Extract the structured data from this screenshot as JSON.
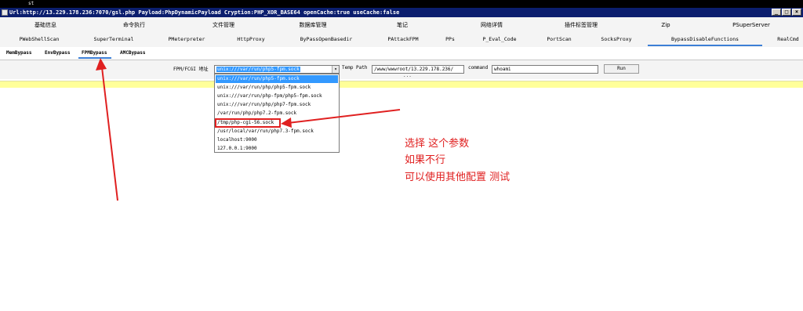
{
  "top_strip_text": "st",
  "window": {
    "title": "Url:http://13.229.178.236:7070/gsl.php Payload:PhpDynamicPayload Cryption:PHP_XOR_BASE64 openCache:true useCache:false",
    "buttons": {
      "minimize": "_",
      "maximize": "□",
      "close": "×"
    }
  },
  "main_menu": [
    "基础信息",
    "命令执行",
    "文件管理",
    "数据库管理",
    "笔记",
    "网络详情",
    "插件标签管理",
    "Zip",
    "PSuperServer"
  ],
  "plugin_menu": [
    "PWebShellScan",
    "SuperTerminal",
    "PMeterpreter",
    "HttpProxy",
    "ByPassOpenBasedir",
    "PAttackFPM",
    "PPs",
    "P_Eval_Code",
    "PortScan",
    "SocksProxy",
    "BypassDisableFunctions",
    "RealCmd"
  ],
  "plugin_menu_active": "BypassDisableFunctions",
  "sub_tabs": [
    "MemBypass",
    "EnvBypass",
    "FPMBypass",
    "AMCBypass"
  ],
  "sub_tabs_active": "FPMBypass",
  "form": {
    "fpm_label": "FPM/FCGI 地址",
    "fpm_value": "unix:///var/run/php5-fpm.sock",
    "dropdown_arrow": "▾",
    "temp_path_label": "Temp Path",
    "temp_path_value": "/www/wwwroot/13.229.178.236/",
    "command_label": "command",
    "command_value": "whoami",
    "run_label": "Run",
    "ellipsis": "..."
  },
  "fpm_options": [
    "unix:///var/run/php5-fpm.sock",
    "unix:///var/run/php/php5-fpm.sock",
    "unix:///var/run/php-fpm/php5-fpm.sock",
    "unix:///var/run/php/php7-fpm.sock",
    "/var/run/php/php7.2-fpm.sock",
    "/tmp/php-cgi-56.sock",
    "/usr/local/var/run/php7.3-fpm.sock",
    "localhost:9000",
    "127.0.0.1:9000"
  ],
  "fpm_options_selected_index": 0,
  "annotation": {
    "line1": "选择  这个参数",
    "line2": "如果不行",
    "line3": "可以使用其他配置 测试",
    "color": "#e02020"
  }
}
